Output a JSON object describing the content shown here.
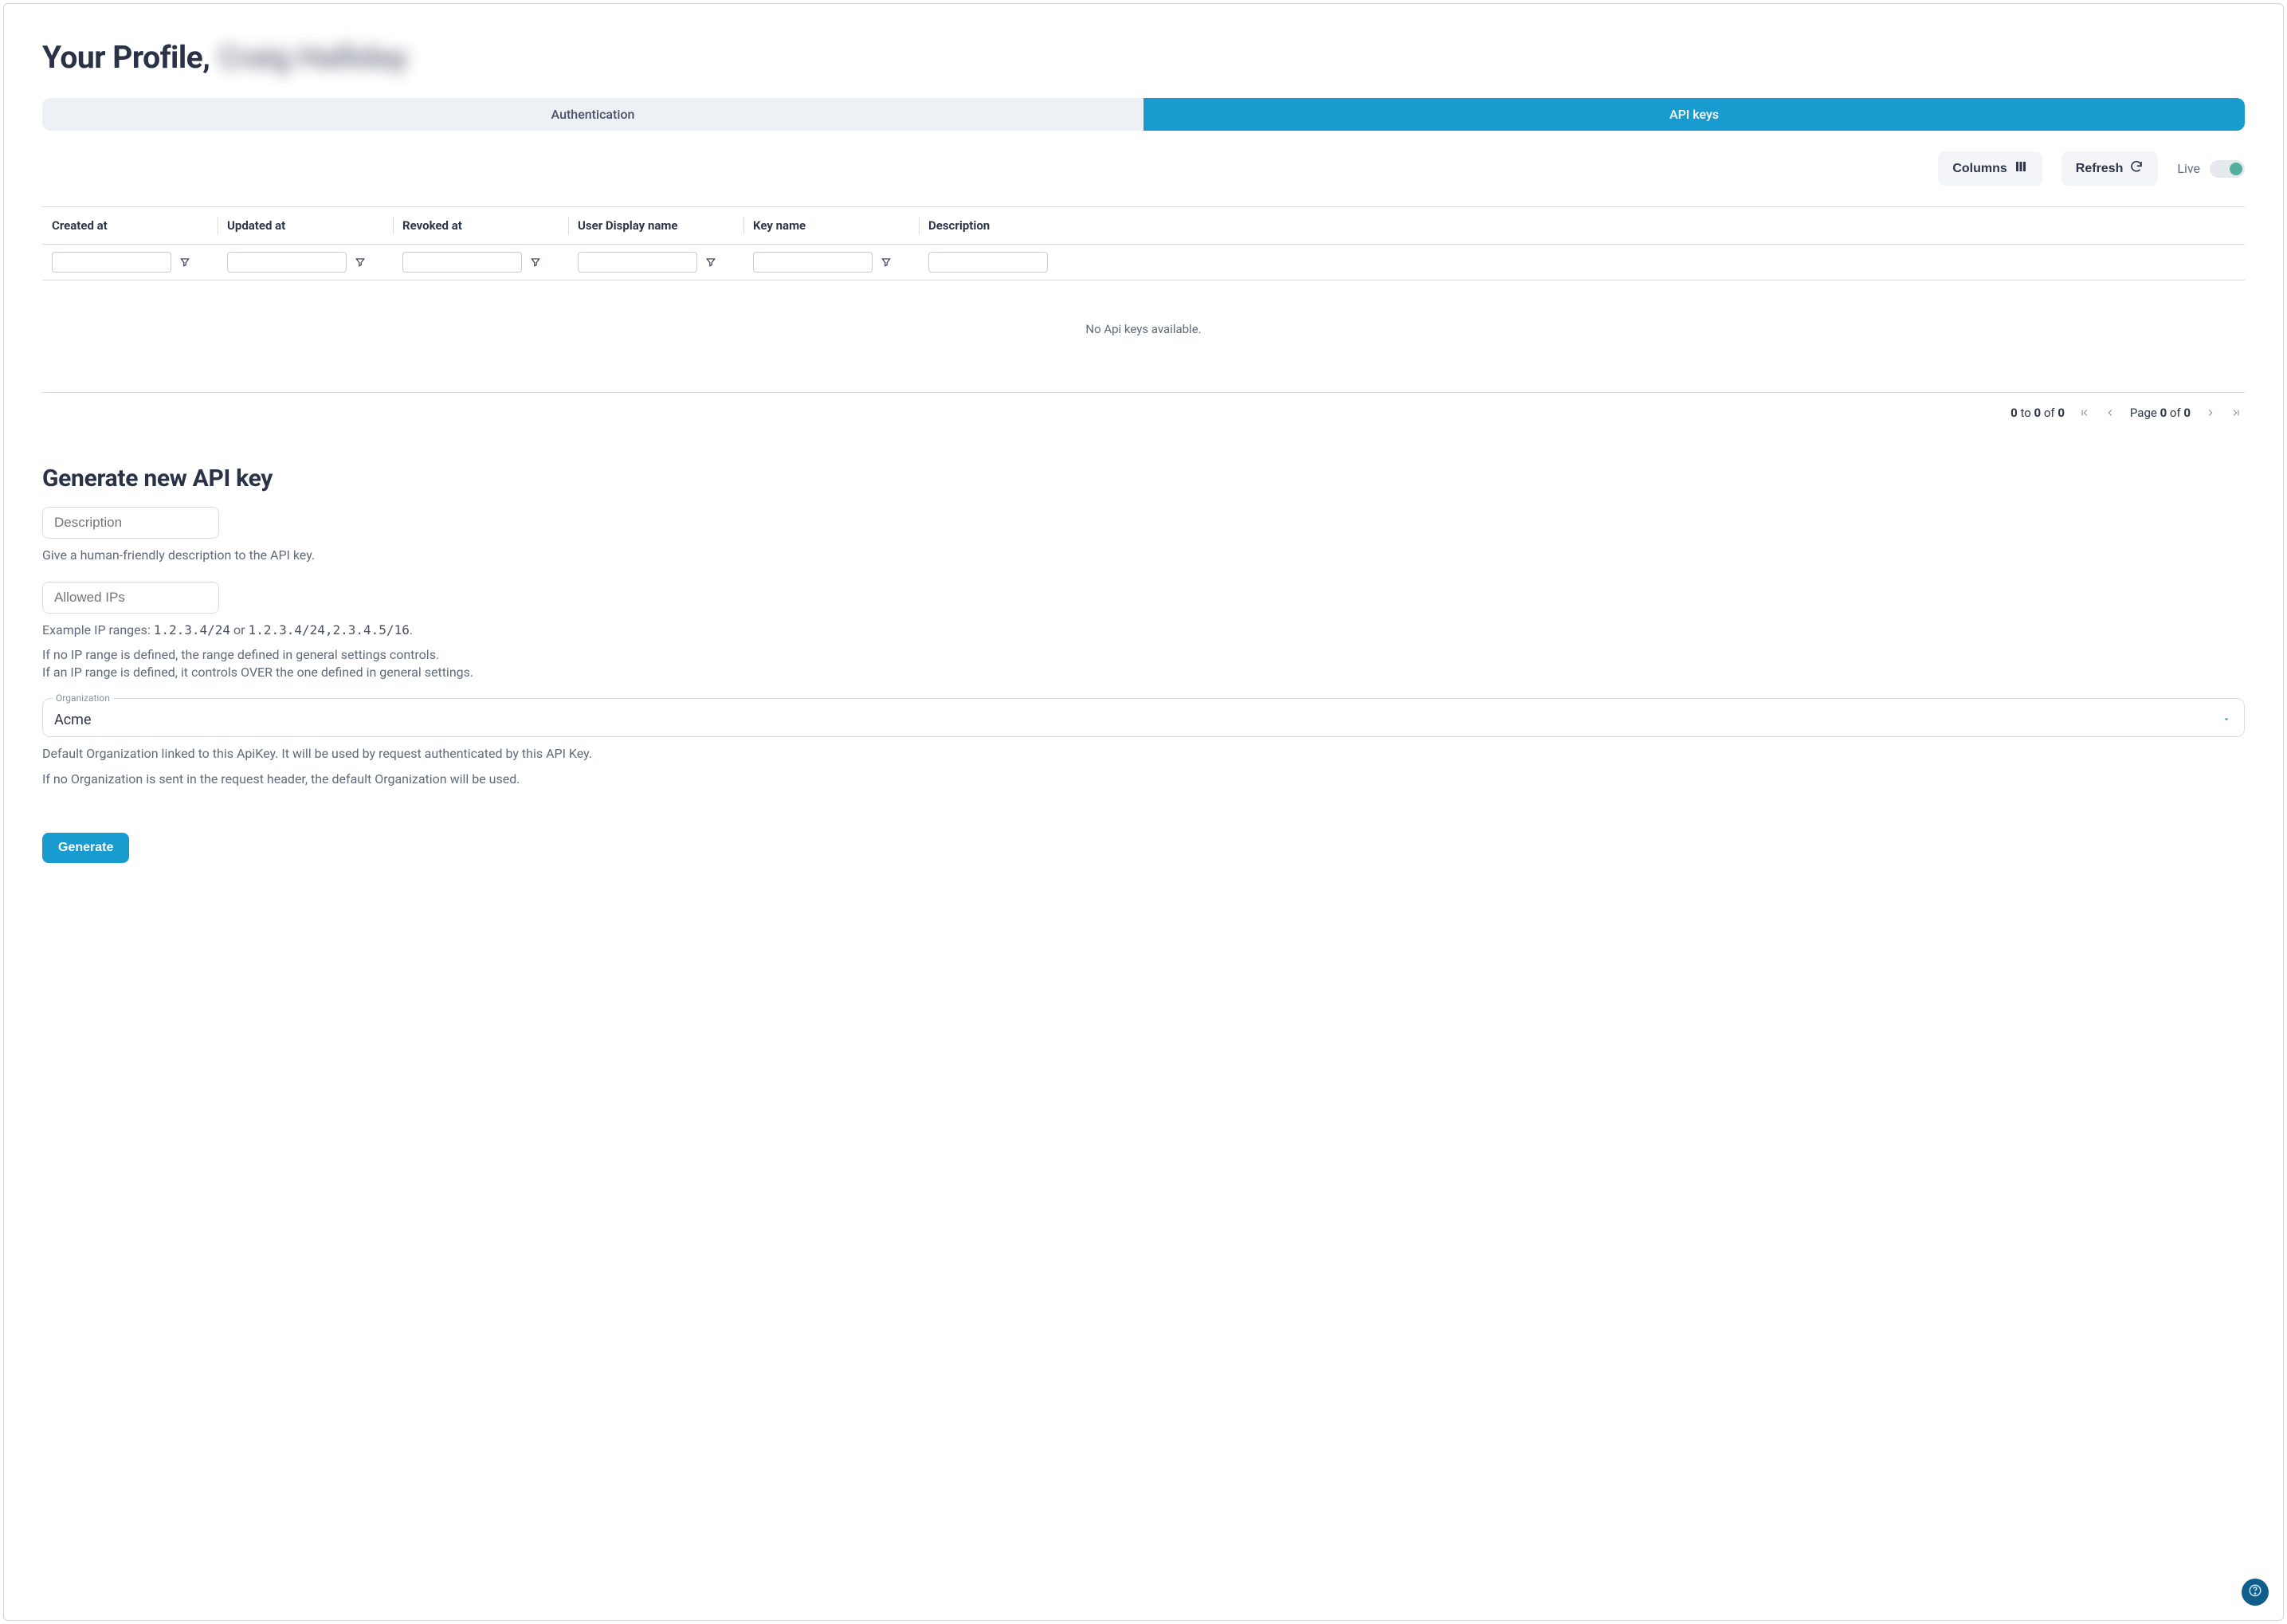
{
  "title_prefix": "Your Profile, ",
  "title_name": "Craig Halliday",
  "tabs": {
    "auth": "Authentication",
    "api": "API keys"
  },
  "toolbar": {
    "columns": "Columns",
    "refresh": "Refresh",
    "live": "Live"
  },
  "grid": {
    "headers": {
      "created": "Created at",
      "updated": "Updated at",
      "revoked": "Revoked at",
      "user": "User Display name",
      "keyname": "Key name",
      "desc": "Description"
    },
    "empty": "No Api keys available."
  },
  "pager": {
    "range_from": "0",
    "range_join_to": " to ",
    "range_to": "0",
    "range_join_of": " of ",
    "range_total": "0",
    "page_label_pre": "Page ",
    "page_current": "0",
    "page_label_mid": " of ",
    "page_total": "0"
  },
  "gen": {
    "title": "Generate new API key",
    "desc_placeholder": "Description",
    "desc_help": "Give a human-friendly description to the API key.",
    "ips_placeholder": "Allowed IPs",
    "ips_help_pre": "Example IP ranges: ",
    "ips_ex1": "1.2.3.4/24",
    "ips_help_or": " or ",
    "ips_ex2": "1.2.3.4/24,2.3.4.5/16",
    "ips_help_post": ".",
    "ips_note1": "If no IP range is defined, the range defined in general settings controls.",
    "ips_note2": "If an IP range is defined, it controls OVER the one defined in general settings.",
    "org_label": "Organization",
    "org_value": "Acme",
    "org_help1": "Default Organization linked to this ApiKey. It will be used by request authenticated by this API Key.",
    "org_help2": "If no Organization is sent in the request header, the default Organization will be used.",
    "submit": "Generate"
  }
}
